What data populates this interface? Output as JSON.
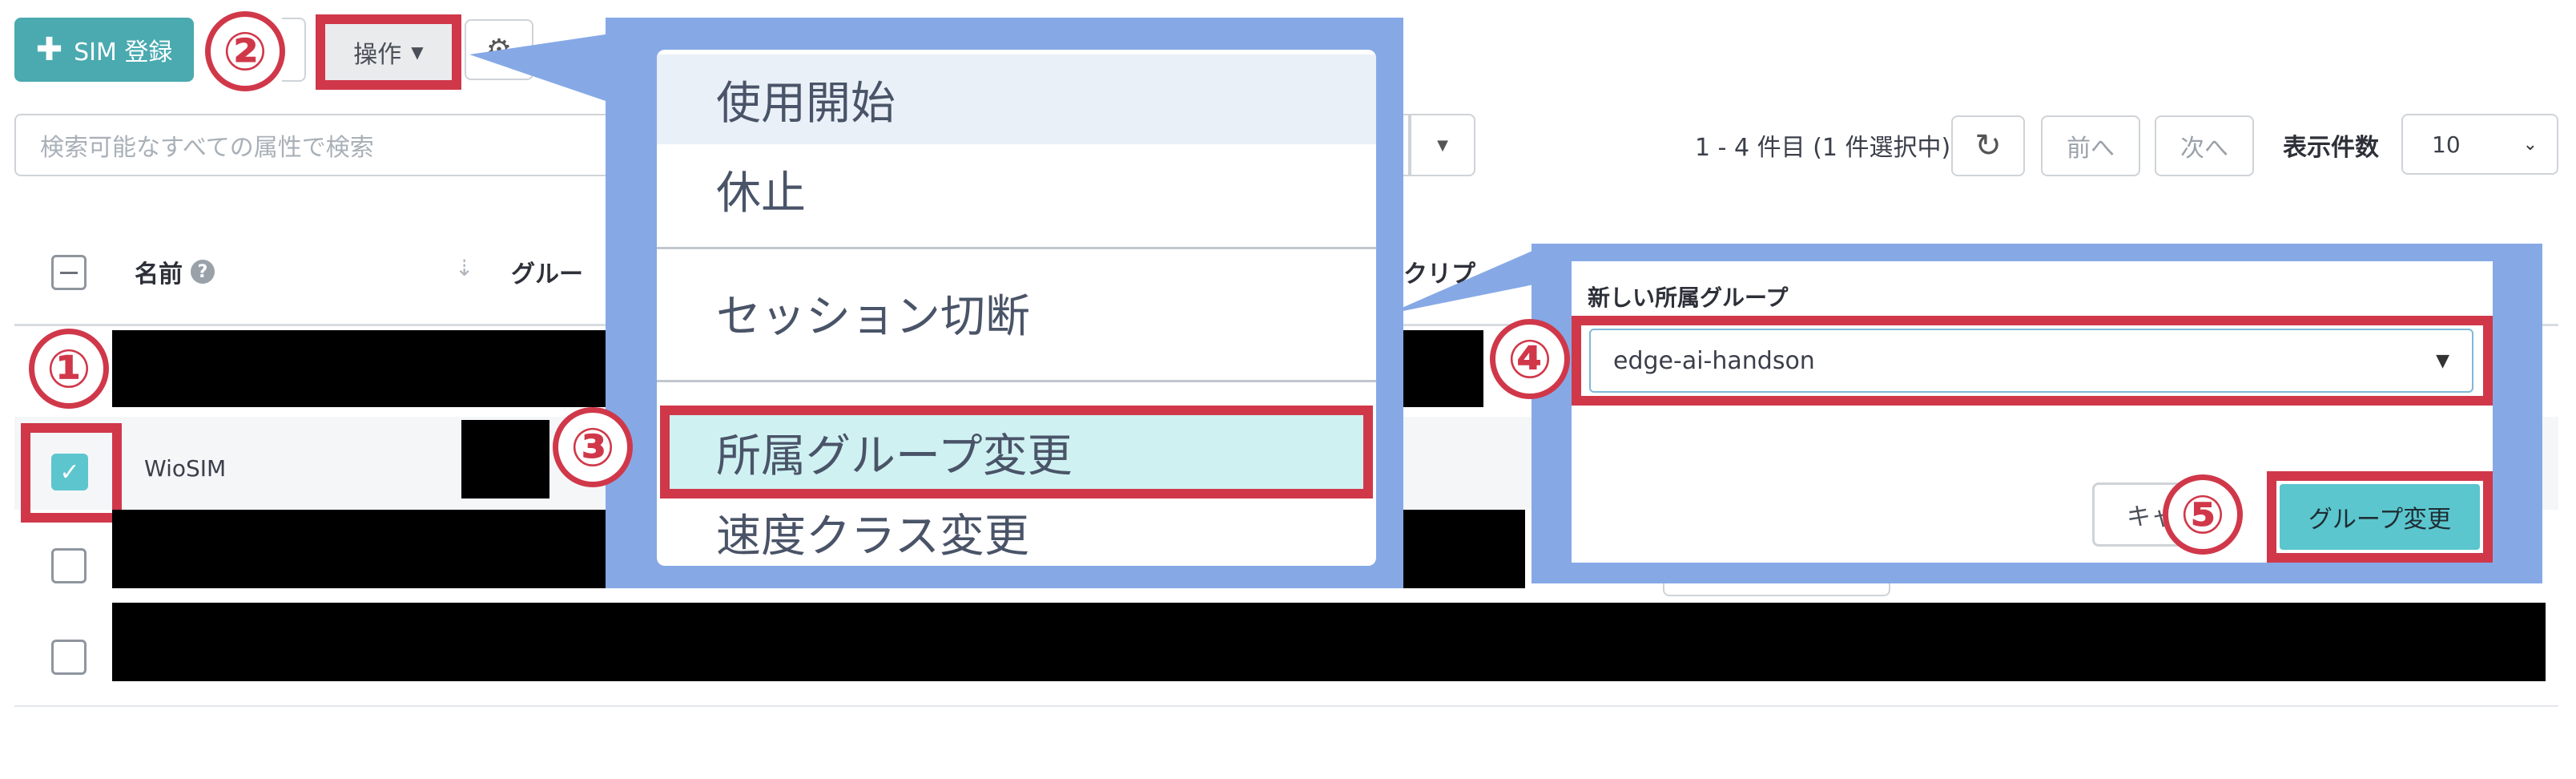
{
  "toolbar": {
    "register_label": "SIM 登録",
    "operation_label": "操作",
    "search_placeholder": "検索可能なすべての属性で検索",
    "page_info": "1 - 4 件目 (1 件選択中)",
    "prev_label": "前へ",
    "next_label": "次へ",
    "per_page_label": "表示件数",
    "per_page_value": "10"
  },
  "table": {
    "col_name": "名前",
    "col_group": "グルー",
    "col_desc": "クリプ",
    "rows": [
      {
        "name": "",
        "checked": false
      },
      {
        "name": "WioSIM",
        "checked": true
      },
      {
        "name": "",
        "checked": false
      },
      {
        "name": "",
        "checked": false
      }
    ]
  },
  "operation_menu": {
    "items": [
      "使用開始",
      "休止",
      "セッション切断",
      "所属グループ変更",
      "速度クラス変更"
    ]
  },
  "group_dialog": {
    "label": "新しい所属グループ",
    "selected_group": "edge-ai-handson",
    "cancel_label": "キャ",
    "submit_label": "グループ変更"
  },
  "callouts": [
    "①",
    "②",
    "③",
    "④",
    "⑤"
  ],
  "colors": {
    "accent": "#4aaab0",
    "highlight": "#d0384a",
    "callout_bg": "#86a9e6",
    "selected_item": "#cff1f2",
    "checkbox_checked": "#5dc5ce"
  }
}
